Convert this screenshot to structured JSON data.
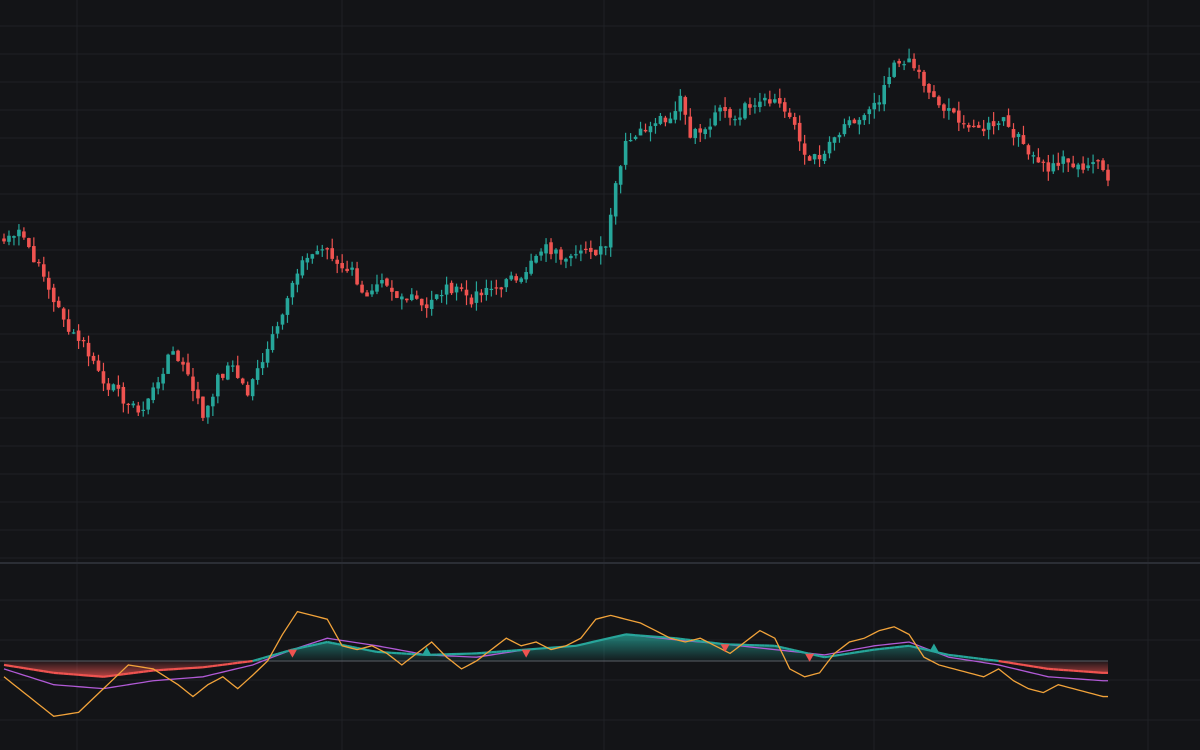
{
  "theme": {
    "background": "#131417",
    "grid": "#1f2126",
    "divider": "#2b2e35",
    "up": "#26a69a",
    "down": "#ef5350",
    "oscillator_fast": "#f2a33a",
    "oscillator_slow": "#b15ad6",
    "oscillator_mid": "#26a69a",
    "zero_line": "#5a5e66"
  },
  "chart_data": [
    {
      "type": "candlestick",
      "title": "",
      "xlabel": "",
      "ylabel": "",
      "grid": true,
      "ylim": [
        50,
        120
      ],
      "x": "bar index 0–222",
      "anchors": [
        [
          0,
          91
        ],
        [
          3,
          93
        ],
        [
          8,
          86
        ],
        [
          12,
          80
        ],
        [
          16,
          77
        ],
        [
          20,
          72
        ],
        [
          23,
          70
        ],
        [
          26,
          68
        ],
        [
          28,
          68
        ],
        [
          31,
          72
        ],
        [
          34,
          76
        ],
        [
          37,
          73
        ],
        [
          40,
          67
        ],
        [
          43,
          72
        ],
        [
          46,
          74
        ],
        [
          49,
          70
        ],
        [
          52,
          75
        ],
        [
          55,
          80
        ],
        [
          58,
          85
        ],
        [
          61,
          89
        ],
        [
          64,
          90
        ],
        [
          67,
          88
        ],
        [
          70,
          87
        ],
        [
          73,
          83
        ],
        [
          76,
          85
        ],
        [
          79,
          83
        ],
        [
          82,
          84
        ],
        [
          85,
          82
        ],
        [
          88,
          84
        ],
        [
          91,
          85
        ],
        [
          94,
          83
        ],
        [
          97,
          84
        ],
        [
          100,
          85
        ],
        [
          103,
          86
        ],
        [
          106,
          88
        ],
        [
          109,
          90
        ],
        [
          112,
          89
        ],
        [
          115,
          90
        ],
        [
          118,
          89
        ],
        [
          121,
          91
        ],
        [
          123,
          99
        ],
        [
          125,
          105
        ],
        [
          128,
          106
        ],
        [
          131,
          108
        ],
        [
          134,
          108
        ],
        [
          136,
          111
        ],
        [
          138,
          106
        ],
        [
          141,
          106
        ],
        [
          144,
          109
        ],
        [
          147,
          108
        ],
        [
          150,
          110
        ],
        [
          153,
          111
        ],
        [
          156,
          110
        ],
        [
          158,
          108
        ],
        [
          161,
          103
        ],
        [
          164,
          102
        ],
        [
          167,
          105
        ],
        [
          170,
          107
        ],
        [
          173,
          108
        ],
        [
          176,
          110
        ],
        [
          179,
          115
        ],
        [
          181,
          116
        ],
        [
          184,
          114
        ],
        [
          186,
          111
        ],
        [
          189,
          109
        ],
        [
          192,
          108
        ],
        [
          195,
          106
        ],
        [
          198,
          107
        ],
        [
          201,
          108
        ],
        [
          204,
          105
        ],
        [
          207,
          103
        ],
        [
          210,
          101
        ],
        [
          213,
          102
        ],
        [
          216,
          101
        ],
        [
          219,
          102
        ],
        [
          222,
          100
        ]
      ]
    },
    {
      "type": "line",
      "title": "",
      "xlabel": "",
      "ylabel": "",
      "grid": true,
      "ylim": [
        -100,
        100
      ],
      "series": [
        {
          "values": [
            [
              0,
              -20
            ],
            [
              5,
              -45
            ],
            [
              10,
              -70
            ],
            [
              15,
              -65
            ],
            [
              20,
              -35
            ],
            [
              25,
              -5
            ],
            [
              30,
              -10
            ],
            [
              35,
              -30
            ],
            [
              38,
              -45
            ],
            [
              41,
              -30
            ],
            [
              44,
              -20
            ],
            [
              47,
              -35
            ],
            [
              50,
              -18
            ],
            [
              53,
              0
            ],
            [
              56,
              35
            ],
            [
              59,
              65
            ],
            [
              62,
              60
            ],
            [
              65,
              55
            ],
            [
              68,
              20
            ],
            [
              71,
              15
            ],
            [
              74,
              20
            ],
            [
              77,
              10
            ],
            [
              80,
              -5
            ],
            [
              83,
              10
            ],
            [
              86,
              25
            ],
            [
              89,
              5
            ],
            [
              92,
              -10
            ],
            [
              95,
              0
            ],
            [
              98,
              15
            ],
            [
              101,
              30
            ],
            [
              104,
              20
            ],
            [
              107,
              25
            ],
            [
              110,
              15
            ],
            [
              113,
              20
            ],
            [
              116,
              30
            ],
            [
              119,
              55
            ],
            [
              122,
              60
            ],
            [
              125,
              55
            ],
            [
              128,
              50
            ],
            [
              131,
              40
            ],
            [
              134,
              30
            ],
            [
              137,
              25
            ],
            [
              140,
              30
            ],
            [
              143,
              20
            ],
            [
              146,
              10
            ],
            [
              149,
              25
            ],
            [
              152,
              40
            ],
            [
              155,
              30
            ],
            [
              158,
              -10
            ],
            [
              161,
              -20
            ],
            [
              164,
              -15
            ],
            [
              167,
              10
            ],
            [
              170,
              25
            ],
            [
              173,
              30
            ],
            [
              176,
              40
            ],
            [
              179,
              45
            ],
            [
              182,
              35
            ],
            [
              185,
              5
            ],
            [
              188,
              -5
            ],
            [
              191,
              -10
            ],
            [
              194,
              -15
            ],
            [
              197,
              -20
            ],
            [
              200,
              -10
            ],
            [
              203,
              -25
            ],
            [
              206,
              -35
            ],
            [
              209,
              -40
            ],
            [
              212,
              -30
            ],
            [
              215,
              -35
            ],
            [
              218,
              -40
            ],
            [
              221,
              -45
            ]
          ]
        },
        {
          "values": [
            [
              0,
              -10
            ],
            [
              10,
              -30
            ],
            [
              20,
              -35
            ],
            [
              30,
              -25
            ],
            [
              40,
              -20
            ],
            [
              50,
              -5
            ],
            [
              58,
              15
            ],
            [
              65,
              30
            ],
            [
              75,
              20
            ],
            [
              85,
              8
            ],
            [
              95,
              5
            ],
            [
              105,
              15
            ],
            [
              115,
              20
            ],
            [
              125,
              35
            ],
            [
              135,
              28
            ],
            [
              145,
              22
            ],
            [
              155,
              15
            ],
            [
              165,
              8
            ],
            [
              175,
              20
            ],
            [
              182,
              25
            ],
            [
              190,
              5
            ],
            [
              200,
              -5
            ],
            [
              210,
              -20
            ],
            [
              221,
              -25
            ]
          ]
        },
        {
          "values": [
            [
              0,
              -5
            ],
            [
              10,
              -15
            ],
            [
              20,
              -20
            ],
            [
              30,
              -12
            ],
            [
              40,
              -8
            ],
            [
              50,
              0
            ],
            [
              58,
              15
            ],
            [
              65,
              25
            ],
            [
              75,
              12
            ],
            [
              85,
              8
            ],
            [
              95,
              10
            ],
            [
              105,
              15
            ],
            [
              115,
              20
            ],
            [
              125,
              35
            ],
            [
              135,
              30
            ],
            [
              145,
              22
            ],
            [
              155,
              20
            ],
            [
              165,
              5
            ],
            [
              175,
              15
            ],
            [
              182,
              20
            ],
            [
              190,
              8
            ],
            [
              200,
              0
            ],
            [
              210,
              -10
            ],
            [
              221,
              -15
            ]
          ]
        }
      ]
    }
  ]
}
